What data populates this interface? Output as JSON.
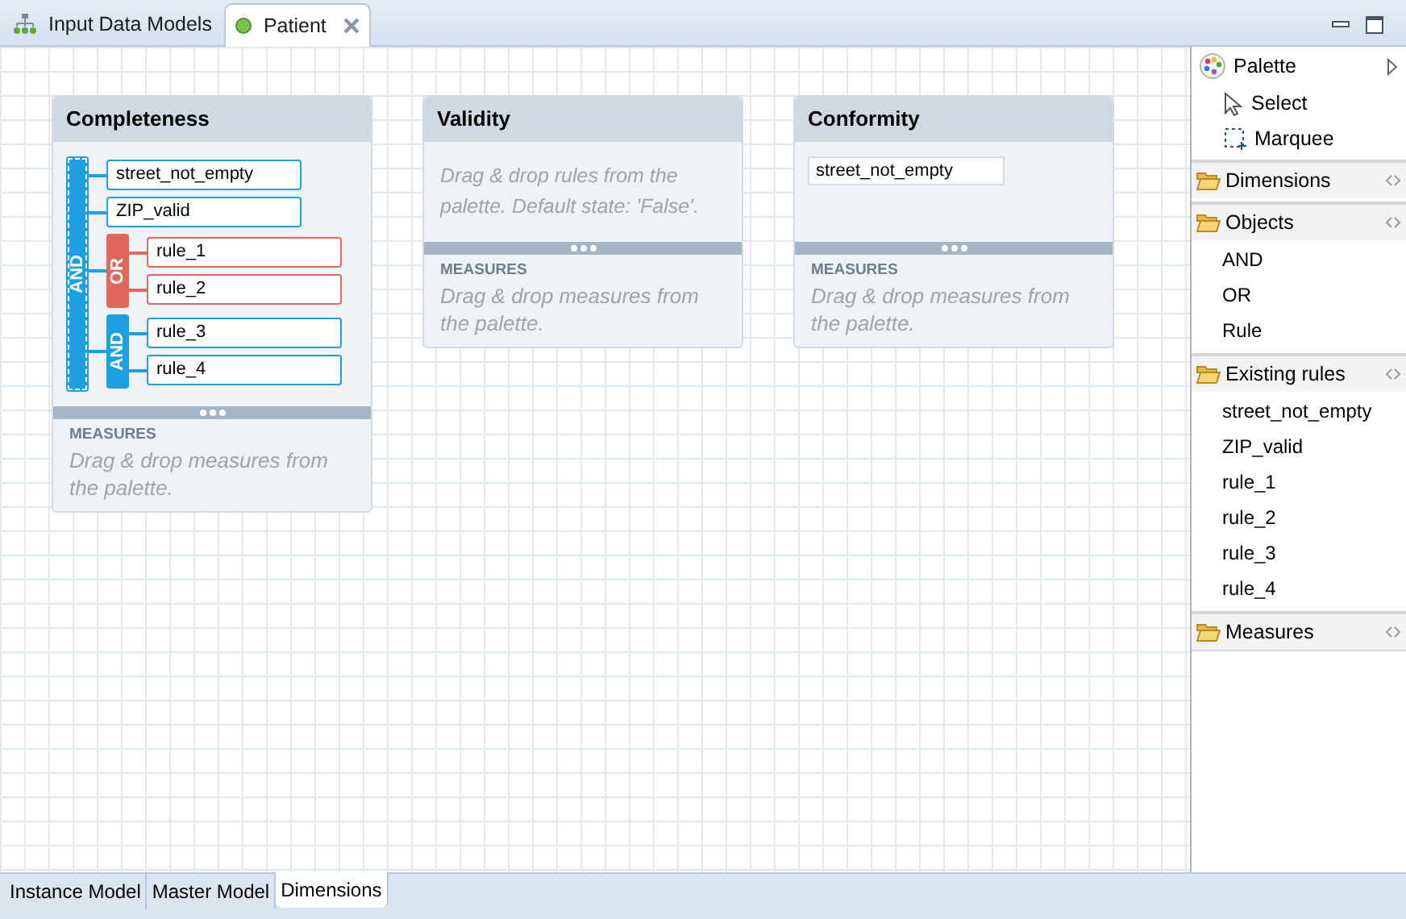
{
  "editor_tabs": [
    {
      "label": "Input Data Models",
      "kind": "models",
      "selected": false,
      "closable": false
    },
    {
      "label": "Patient",
      "kind": "editor",
      "selected": true,
      "closable": true
    }
  ],
  "cards": [
    {
      "title": "Completeness",
      "rules": [
        {
          "kind": "and",
          "label": "AND",
          "selected": true,
          "children": [
            {
              "kind": "rule",
              "label": "street_not_empty"
            },
            {
              "kind": "rule",
              "label": "ZIP_valid"
            },
            {
              "kind": "or",
              "label": "OR",
              "selected": false,
              "children": [
                {
                  "kind": "rule",
                  "label": "rule_1"
                },
                {
                  "kind": "rule",
                  "label": "rule_2"
                }
              ]
            },
            {
              "kind": "and",
              "label": "AND",
              "selected": false,
              "children": [
                {
                  "kind": "rule",
                  "label": "rule_3"
                },
                {
                  "kind": "rule",
                  "label": "rule_4"
                }
              ]
            }
          ]
        }
      ],
      "measures_label": "MEASURES",
      "measures_placeholder": "Drag & drop measures from the palette."
    },
    {
      "title": "Validity",
      "rules_placeholder": "Drag & drop rules from the palette. Default state: 'False'.",
      "measures_label": "MEASURES",
      "measures_placeholder": "Drag & drop measures from the palette."
    },
    {
      "title": "Conformity",
      "rules": [
        {
          "kind": "plain",
          "label": "street_not_empty"
        }
      ],
      "measures_label": "MEASURES",
      "measures_placeholder": "Drag & drop measures from the palette."
    }
  ],
  "palette": {
    "title": "Palette",
    "tools": [
      {
        "kind": "select",
        "label": "Select"
      },
      {
        "kind": "marquee",
        "label": "Marquee"
      }
    ],
    "drawers": [
      {
        "label": "Dimensions"
      },
      {
        "label": "Objects",
        "items": [
          "AND",
          "OR",
          "Rule"
        ]
      },
      {
        "label": "Existing rules",
        "items": [
          "street_not_empty",
          "ZIP_valid",
          "rule_1",
          "rule_2",
          "rule_3",
          "rule_4"
        ]
      },
      {
        "label": "Measures"
      }
    ]
  },
  "bottom_tabs": [
    {
      "label": "Instance Model",
      "selected": false
    },
    {
      "label": "Master Model",
      "selected": false
    },
    {
      "label": "Dimensions",
      "selected": true
    }
  ]
}
